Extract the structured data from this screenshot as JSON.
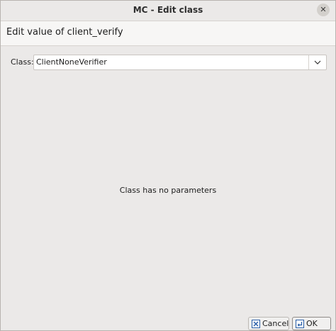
{
  "window": {
    "title": "MC - Edit class",
    "close_icon": "close-icon"
  },
  "header": {
    "text": "Edit value of client_verify"
  },
  "form": {
    "class_label": "Class:",
    "class_value": "ClientNoneVerifier",
    "dropdown_icon": "chevron-down-icon"
  },
  "main": {
    "message": "Class has no parameters"
  },
  "buttons": {
    "cancel_label": "Cancel",
    "cancel_icon": "cancel-icon",
    "ok_label": "OK",
    "ok_icon": "enter-return-icon"
  }
}
